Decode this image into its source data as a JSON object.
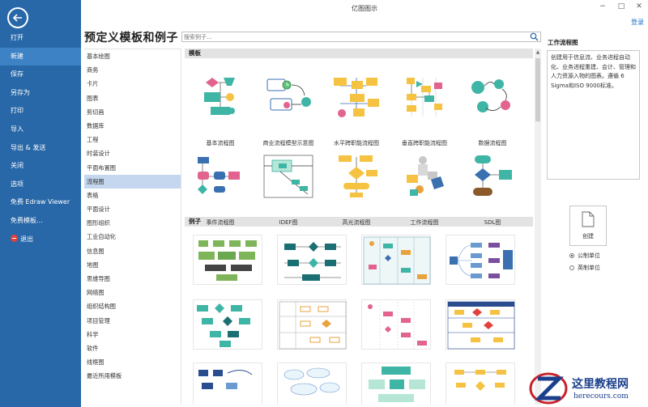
{
  "app": {
    "title": "亿图图示",
    "login": "登录",
    "heading": "预定义模板和例子"
  },
  "window": {
    "minimize": "−",
    "maximize": "□",
    "close": "✕"
  },
  "sidebar": {
    "items": [
      {
        "label": "打开"
      },
      {
        "label": "新建"
      },
      {
        "label": "保存"
      },
      {
        "label": "另存为"
      },
      {
        "label": "打印"
      },
      {
        "label": "导入"
      },
      {
        "label": "导出 & 发送"
      },
      {
        "label": "关闭"
      },
      {
        "label": "选项"
      },
      {
        "label": "免费 Edraw Viewer"
      },
      {
        "label": "免费模板..."
      },
      {
        "label": "退出"
      }
    ]
  },
  "search": {
    "placeholder": "搜索例子..."
  },
  "categories": [
    {
      "label": "基本绘图"
    },
    {
      "label": "商务"
    },
    {
      "label": "卡片"
    },
    {
      "label": "图表"
    },
    {
      "label": "剪切画"
    },
    {
      "label": "数据库"
    },
    {
      "label": "工程"
    },
    {
      "label": "时装设计"
    },
    {
      "label": "平面布置图"
    },
    {
      "label": "流程图"
    },
    {
      "label": "表格"
    },
    {
      "label": "平面设计"
    },
    {
      "label": "图形组织"
    },
    {
      "label": "工业自动化"
    },
    {
      "label": "信息图"
    },
    {
      "label": "地图"
    },
    {
      "label": "思维导图"
    },
    {
      "label": "网络图"
    },
    {
      "label": "组织结构图"
    },
    {
      "label": "项目管理"
    },
    {
      "label": "科学"
    },
    {
      "label": "软件"
    },
    {
      "label": "线框图"
    },
    {
      "label": "最近所用模板"
    }
  ],
  "sections": {
    "templates": "模板",
    "examples": "例子"
  },
  "templates": [
    {
      "label": "基本流程图"
    },
    {
      "label": "商业流程模型示意图"
    },
    {
      "label": "水平跨职能流程图"
    },
    {
      "label": "垂直跨职能流程图"
    },
    {
      "label": "数据流程图"
    },
    {
      "label": "事件流程图"
    },
    {
      "label": "IDEF图"
    },
    {
      "label": "高光流程图"
    },
    {
      "label": "工作流程图"
    },
    {
      "label": "SDL图"
    }
  ],
  "right_panel": {
    "title": "工作流程图",
    "description": "创建用于信息流、业务进程自动化、业务进程重建、会计、管理和人力资源入物的图表。遵循 6 Sigma和ISO 9000标准。",
    "create_label": "创建",
    "units": [
      {
        "label": "公制单位"
      },
      {
        "label": "英制单位"
      }
    ]
  },
  "watermark": {
    "line1": "这里教程网",
    "line2": "herecours.com"
  },
  "colors": {
    "sidebar": "#2868a8",
    "sidebar_active": "#3d82c4",
    "category_active": "#c4d7ee",
    "teal": "#3fb5a6",
    "yellow": "#f5c242",
    "pink": "#e2638f",
    "navy": "#1b3f8c"
  }
}
